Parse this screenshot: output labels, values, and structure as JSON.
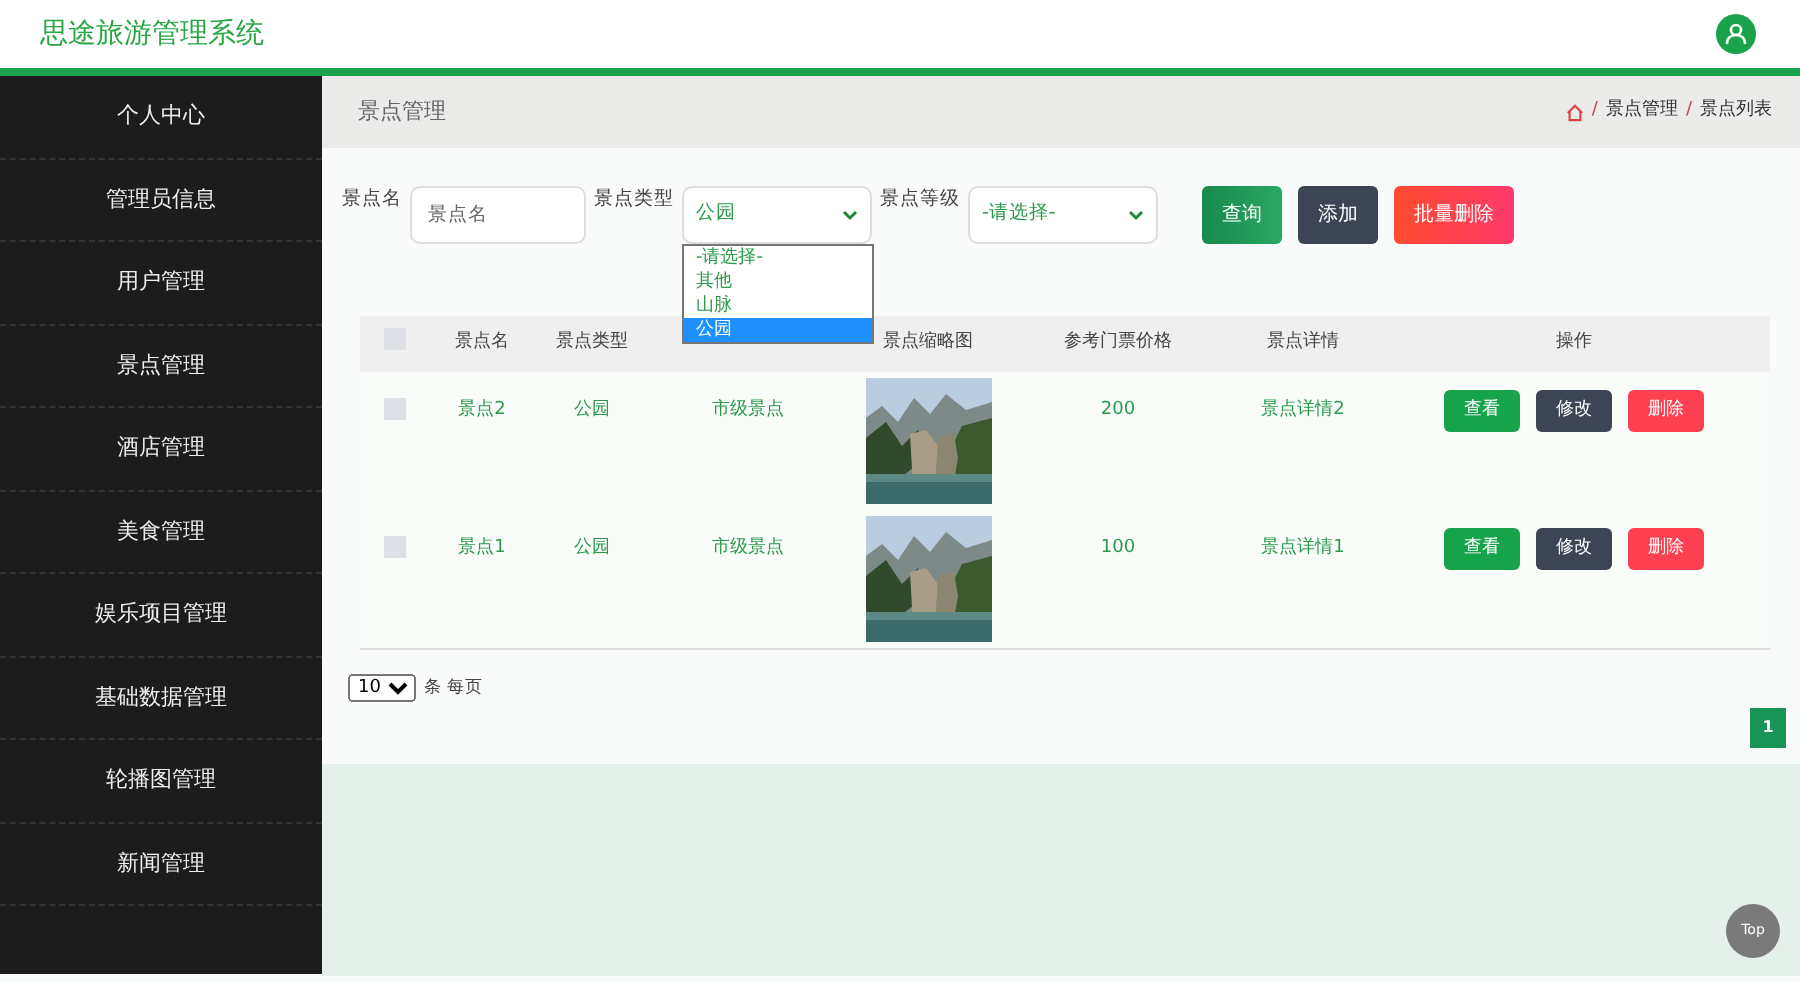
{
  "app_title": "思途旅游管理系统",
  "sidebar": {
    "items": [
      {
        "label": "个人中心"
      },
      {
        "label": "管理员信息"
      },
      {
        "label": "用户管理"
      },
      {
        "label": "景点管理"
      },
      {
        "label": "酒店管理"
      },
      {
        "label": "美食管理"
      },
      {
        "label": "娱乐项目管理"
      },
      {
        "label": "基础数据管理"
      },
      {
        "label": "轮播图管理"
      },
      {
        "label": "新闻管理"
      }
    ]
  },
  "page_title": "景点管理",
  "breadcrumb": [
    {
      "kind": "separator",
      "text": "/"
    },
    {
      "kind": "link",
      "text": "景点管理"
    },
    {
      "kind": "separator",
      "text": "/"
    },
    {
      "kind": "link",
      "text": "景点列表"
    }
  ],
  "search": {
    "name_label": "景点名",
    "name_placeholder": "景点名",
    "type_label": "景点类型",
    "type_value": "公园",
    "type_options": [
      {
        "label": "-请选择-",
        "selected": false
      },
      {
        "label": "其他",
        "selected": false
      },
      {
        "label": "山脉",
        "selected": false
      },
      {
        "label": "公园",
        "selected": true
      }
    ],
    "level_label": "景点等级",
    "level_value": "-请选择-"
  },
  "buttons": [
    {
      "label": "查询",
      "kind": "search"
    },
    {
      "label": "添加",
      "kind": "add"
    },
    {
      "label": "批量删除",
      "kind": "delete"
    }
  ],
  "table": {
    "select_all_checked": false,
    "columns": [
      {
        "label": "景点名"
      },
      {
        "label": "景点类型"
      },
      {},
      {
        "label": "景点缩略图"
      },
      {
        "label": "参考门票价格"
      },
      {
        "label": "景点详情"
      },
      {
        "label": "操作"
      }
    ],
    "rows": [
      {
        "checked": false,
        "cells": [
          {
            "kind": "text",
            "text": "景点2"
          },
          {
            "kind": "text",
            "text": "公园"
          },
          {
            "kind": "text",
            "text": "市级景点"
          },
          {
            "kind": "picture"
          },
          {
            "kind": "text",
            "text": "200"
          },
          {
            "kind": "link",
            "text": "景点详情2"
          }
        ],
        "actions": [
          "查看",
          "修改",
          "删除"
        ]
      },
      {
        "checked": false,
        "cells": [
          {
            "kind": "text",
            "text": "景点1"
          },
          {
            "kind": "text",
            "text": "公园"
          },
          {
            "kind": "text",
            "text": "市级景点"
          },
          {
            "kind": "picture"
          },
          {
            "kind": "text",
            "text": "100"
          },
          {
            "kind": "link",
            "text": "景点详情1"
          }
        ],
        "actions": [
          "查看",
          "修改",
          "删除"
        ]
      }
    ]
  },
  "page_size": "10",
  "page_size_label": "条 每页",
  "pages": [
    {
      "label": "1",
      "selected": true
    }
  ],
  "top_button": "Top"
}
